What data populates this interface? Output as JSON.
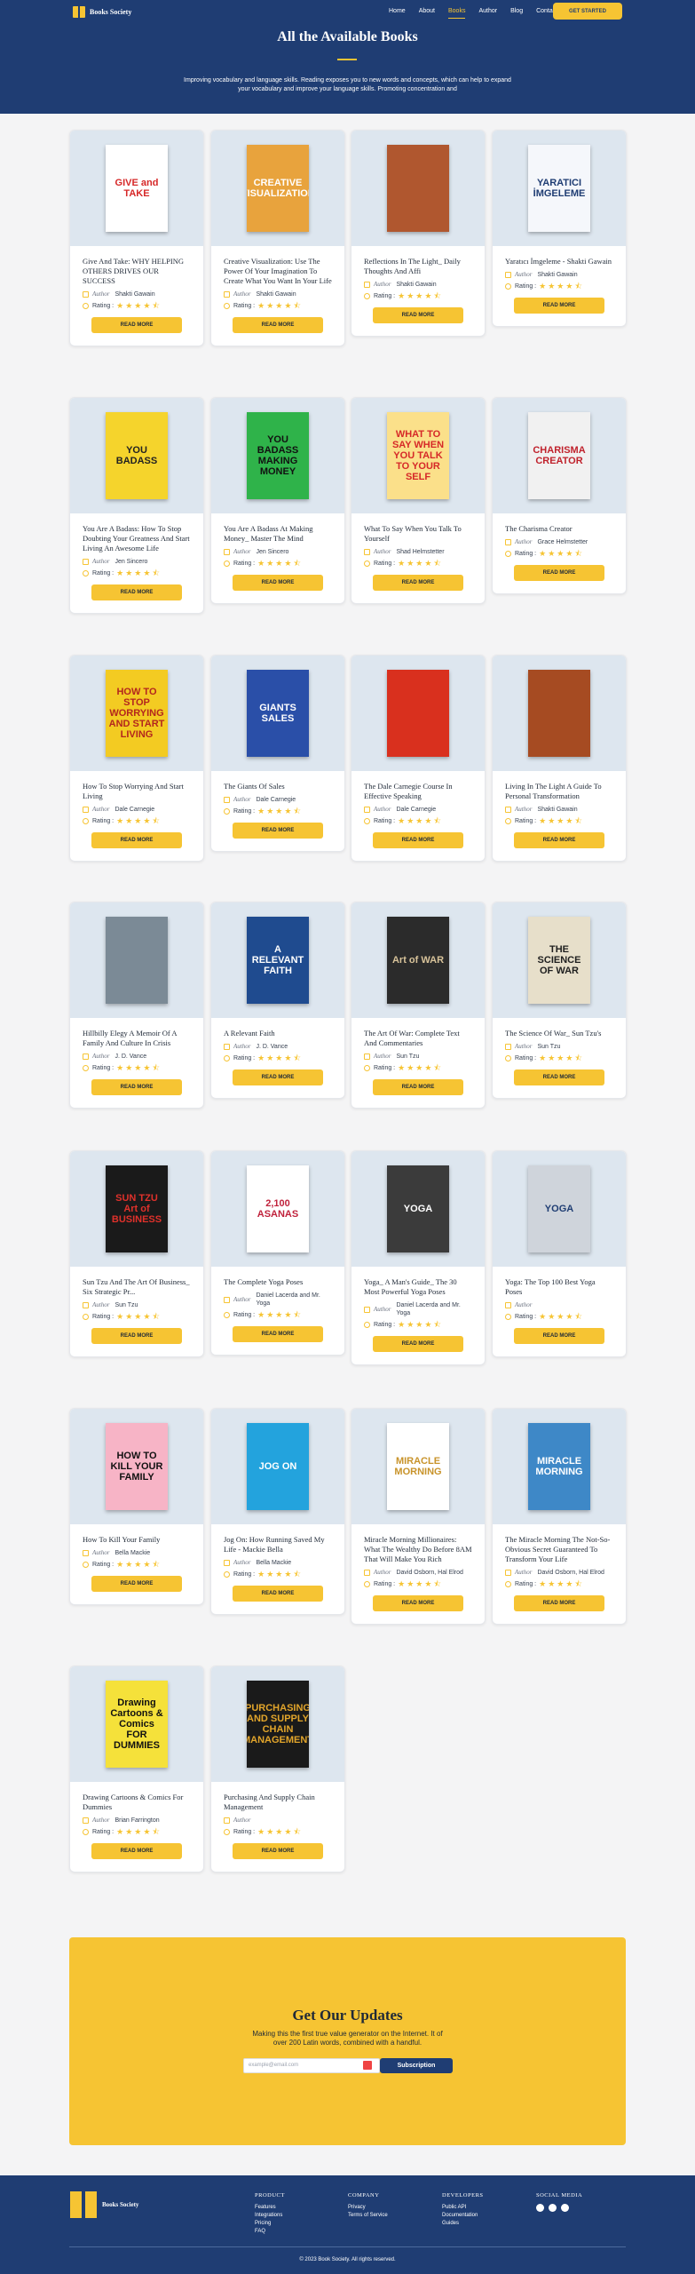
{
  "header": {
    "logo_text": "Books Society",
    "nav": [
      "Home",
      "About",
      "Books",
      "Author",
      "Blog",
      "Contact"
    ],
    "active_nav": "Books",
    "cta": "GET STARTED",
    "title": "All the Available Books",
    "intro": "Improving vocabulary and language skills. Reading exposes you to new words and concepts, which can help to expand your vocabulary and improve your language skills. Promoting concentration and"
  },
  "labels": {
    "author": "Author",
    "rating": "Rating :",
    "read_more": "READ MORE"
  },
  "books": [
    {
      "title": "Give And Take: WHY HELPING OTHERS DRIVES OUR SUCCESS",
      "author": "Shakti Gawain",
      "stars": 4.5,
      "cover_text": "GIVE and TAKE",
      "cover_bg": "#ffffff",
      "cover_fg": "#d62828"
    },
    {
      "title": "Creative Visualization: Use The Power Of Your Imagination To Create What You Want In Your Life",
      "author": "Shakti Gawain",
      "stars": 4.5,
      "cover_text": "CREATIVE VISUALIZATION",
      "cover_bg": "#e8a33d",
      "cover_fg": "#ffffff"
    },
    {
      "title": "Reflections In The Light_ Daily Thoughts And Affi",
      "author": "Shakti Gawain",
      "stars": 4.5,
      "cover_text": "",
      "cover_bg": "#b0572f",
      "cover_fg": "#ffffff"
    },
    {
      "title": "Yaratıcı İmgeleme - Shakti Gawain",
      "author": "Shakti Gawain",
      "stars": 4.5,
      "cover_text": "YARATICI İMGELEME",
      "cover_bg": "#f5f7fb",
      "cover_fg": "#1f3d73"
    },
    {
      "title": "You Are A Badass: How To Stop Doubting Your Greatness And Start Living An Awesome Life",
      "author": "Jen Sincero",
      "stars": 4.5,
      "cover_text": "YOU BADASS",
      "cover_bg": "#f5d42c",
      "cover_fg": "#222222"
    },
    {
      "title": "You Are A Badass At Making Money_ Master The Mind",
      "author": "Jen Sincero",
      "stars": 4.5,
      "cover_text": "YOU BADASS MAKING MONEY",
      "cover_bg": "#2fb34a",
      "cover_fg": "#111111"
    },
    {
      "title": "What To Say When You Talk To Yourself",
      "author": "Shad Helmstetter",
      "stars": 4.5,
      "cover_text": "WHAT TO SAY WHEN YOU TALK TO YOUR SELF",
      "cover_bg": "#fbe08a",
      "cover_fg": "#d62828"
    },
    {
      "title": "The Charisma Creator",
      "author": "Grace Helmstetter",
      "stars": 4.5,
      "cover_text": "CHARISMA CREATOR",
      "cover_bg": "#f1f1f1",
      "cover_fg": "#c0222c"
    },
    {
      "title": "How To Stop Worrying And Start Living",
      "author": "Dale Carnegie",
      "stars": 4.5,
      "cover_text": "HOW TO STOP WORRYING AND START LIVING",
      "cover_bg": "#f3cb22",
      "cover_fg": "#b3261e"
    },
    {
      "title": "The Giants Of Sales",
      "author": "Dale Carnegie",
      "stars": 4.5,
      "cover_text": "GIANTS SALES",
      "cover_bg": "#2a4fa8",
      "cover_fg": "#ffffff"
    },
    {
      "title": "The Dale Carnegie Course In Effective Speaking",
      "author": "Dale Carnegie",
      "stars": 4.5,
      "cover_text": "",
      "cover_bg": "#d9301e",
      "cover_fg": "#ffffff"
    },
    {
      "title": "Living In The Light A Guide To Personal Transformation",
      "author": "Shakti Gawain",
      "stars": 4.5,
      "cover_text": "",
      "cover_bg": "#a64b22",
      "cover_fg": "#f6c433"
    },
    {
      "title": "Hillbilly Elegy A Memoir Of A Family And Culture In Crisis",
      "author": "J. D. Vance",
      "stars": 4.5,
      "cover_text": "",
      "cover_bg": "#7b8a96",
      "cover_fg": "#ffffff"
    },
    {
      "title": "A Relevant Faith",
      "author": "J. D. Vance",
      "stars": 4.5,
      "cover_text": "A RELEVANT FAITH",
      "cover_bg": "#1f4b8f",
      "cover_fg": "#ffffff"
    },
    {
      "title": "The Art Of War: Complete Text And Commentaries",
      "author": "Sun Tzu",
      "stars": 4.5,
      "cover_text": "Art of WAR",
      "cover_bg": "#2b2b2b",
      "cover_fg": "#d8c39a"
    },
    {
      "title": "The Science Of War_ Sun Tzu's",
      "author": "Sun Tzu",
      "stars": 4.5,
      "cover_text": "THE SCIENCE OF WAR",
      "cover_bg": "#e7dfca",
      "cover_fg": "#1f1f1f"
    },
    {
      "title": "Sun Tzu And The Art Of Business_ Six Strategic Pr...",
      "author": "Sun Tzu",
      "stars": 4.5,
      "cover_text": "SUN TZU Art of BUSINESS",
      "cover_bg": "#1a1a1a",
      "cover_fg": "#e0312b"
    },
    {
      "title": "The Complete Yoga Poses",
      "author": "Daniel Lacerda and Mr. Yoga",
      "stars": 4.5,
      "cover_text": "2,100 ASANAS",
      "cover_bg": "#ffffff",
      "cover_fg": "#c0223c"
    },
    {
      "title": "Yoga_ A Man's Guide_ The 30 Most Powerful Yoga Poses",
      "author": "Daniel Lacerda and Mr. Yoga",
      "stars": 4.5,
      "cover_text": "YOGA",
      "cover_bg": "#3b3b3b",
      "cover_fg": "#ffffff"
    },
    {
      "title": "Yoga: The Top 100 Best Yoga Poses",
      "author": "",
      "stars": 4.5,
      "cover_text": "YOGA",
      "cover_bg": "#cfd4db",
      "cover_fg": "#1f3d73"
    },
    {
      "title": "How To Kill Your Family",
      "author": "Bella Mackie",
      "stars": 4.5,
      "cover_text": "HOW TO KILL YOUR FAMILY",
      "cover_bg": "#f7b4c6",
      "cover_fg": "#111111"
    },
    {
      "title": "Jog On: How Running Saved My Life - Mackie Bella",
      "author": "Bella Mackie",
      "stars": 4.5,
      "cover_text": "JOG ON",
      "cover_bg": "#23a3dd",
      "cover_fg": "#ffffff"
    },
    {
      "title": "Miracle Morning Millionaires: What The Wealthy Do Before 8AM That Will Make You Rich",
      "author": "David Osborn, Hal Elrod",
      "stars": 4.5,
      "cover_text": "MIRACLE MORNING",
      "cover_bg": "#ffffff",
      "cover_fg": "#c8932a"
    },
    {
      "title": "The Miracle Morning The Not-So-Obvious Secret Guaranteed To Transform Your Life",
      "author": "David Osborn, Hal Elrod",
      "stars": 4.5,
      "cover_text": "MIRACLE MORNING",
      "cover_bg": "#3e88c7",
      "cover_fg": "#ffffff"
    },
    {
      "title": "Drawing Cartoons & Comics For Dummies",
      "author": "Brian Farrington",
      "stars": 4.5,
      "cover_text": "Drawing Cartoons & Comics FOR DUMMIES",
      "cover_bg": "#f5e13a",
      "cover_fg": "#111111"
    },
    {
      "title": "Purchasing And Supply Chain Management",
      "author": "",
      "stars": 4.5,
      "cover_text": "PURCHASING AND SUPPLY CHAIN MANAGEMENT",
      "cover_bg": "#1a1a1a",
      "cover_fg": "#e2a52b"
    }
  ],
  "updates": {
    "title": "Get Our Updates",
    "text": "Making this the first true value generator on the Internet. It of over 200 Latin words, combined with a handful.",
    "placeholder": "example@email.com",
    "button": "Subscription"
  },
  "footer": {
    "logo_text": "Books Society",
    "columns": [
      {
        "heading": "PRODUCT",
        "links": [
          "Features",
          "Integrations",
          "Pricing",
          "FAQ"
        ]
      },
      {
        "heading": "COMPANY",
        "links": [
          "Privacy",
          "Terms of Service"
        ]
      },
      {
        "heading": "DEVELOPERS",
        "links": [
          "Public API",
          "Documentation",
          "Guides"
        ]
      }
    ],
    "social_heading": "SOCIAL MEDIA",
    "social_icons": [
      "facebook-icon",
      "twitter-icon",
      "instagram-icon"
    ],
    "copyright": "© 2023 Book Society. All rights reserved."
  }
}
